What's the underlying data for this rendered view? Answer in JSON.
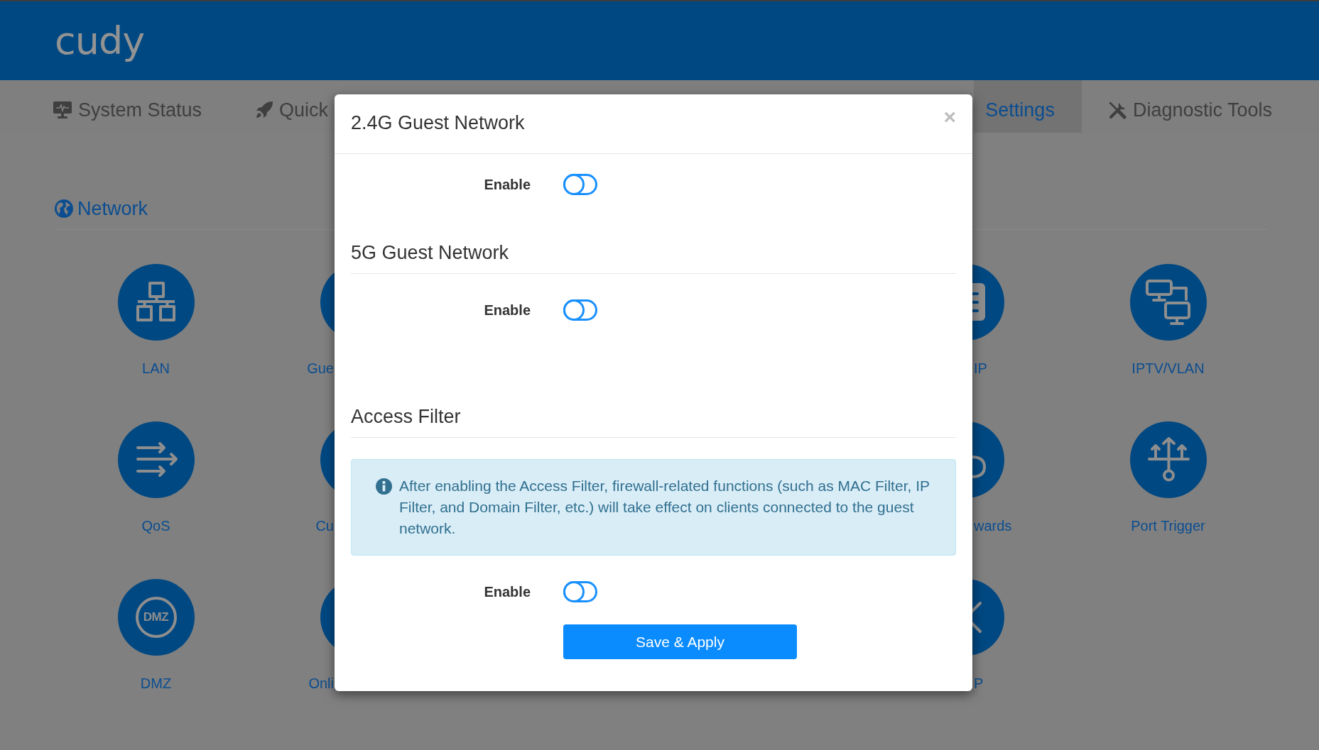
{
  "header": {
    "logo": "cudy"
  },
  "nav": [
    {
      "label": "System Status",
      "selected": false
    },
    {
      "label": "Quick",
      "selected": false
    },
    {
      "label": "Settings",
      "selected": true
    },
    {
      "label": "Diagnostic Tools",
      "selected": false
    }
  ],
  "section": {
    "title": "Network",
    "rows": [
      {
        "tiles": [
          {
            "label": "LAN"
          },
          {
            "label": "Gue"
          },
          {
            "label": "IP"
          },
          {
            "label": "IPTV/VLAN"
          }
        ]
      },
      {
        "tiles": [
          {
            "label": "QoS"
          },
          {
            "label": "Cu"
          },
          {
            "label": "wards"
          },
          {
            "label": "Port Trigger"
          }
        ]
      },
      {
        "tiles": [
          {
            "label": "DMZ",
            "icon_text": "DMZ"
          },
          {
            "label": "Onli"
          },
          {
            "label": "P"
          }
        ]
      }
    ]
  },
  "dialog": {
    "title": "2.4G Guest Network",
    "close": "×",
    "items": [
      {
        "kind": "toggle",
        "label": "Enable",
        "on": false
      },
      {
        "kind": "heading",
        "text": "5G Guest Network"
      },
      {
        "kind": "toggle",
        "label": "Enable",
        "on": false
      },
      {
        "kind": "heading",
        "text": "Access Filter"
      },
      {
        "kind": "note",
        "text": "After enabling the Access Filter, firewall-related functions (such as MAC Filter, IP Filter, and Domain Filter, etc.) will take effect on clients connected to the guest network."
      },
      {
        "kind": "toggle",
        "label": "Enable",
        "on": false
      }
    ],
    "button": "Save & Apply"
  }
}
